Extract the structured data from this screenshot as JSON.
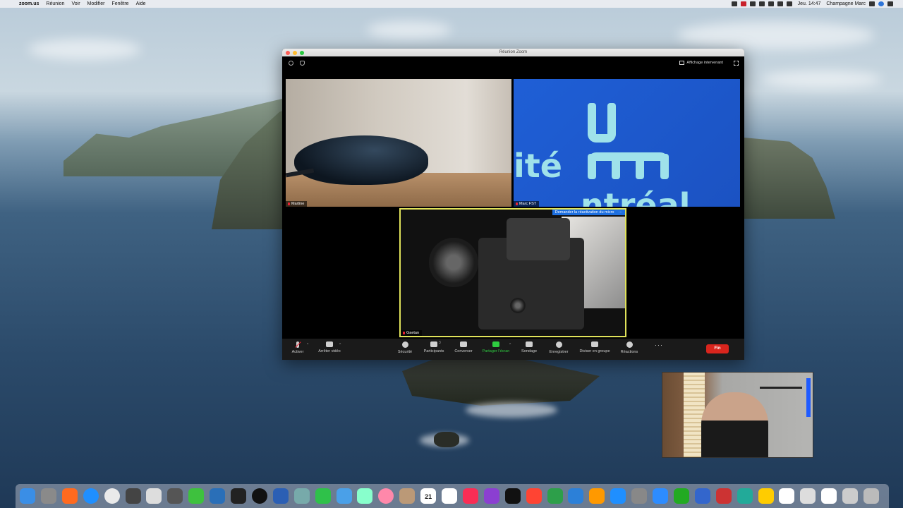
{
  "menubar": {
    "app_name": "zoom.us",
    "menus": [
      "Réunion",
      "Voir",
      "Modifier",
      "Fenêtre",
      "Aide"
    ],
    "clock": "Jeu. 14:47",
    "user": "Champagne Marc"
  },
  "window": {
    "title": "Réunion Zoom",
    "speaker_view_label": "Affichage intervenant"
  },
  "participants": {
    "martine": "Martine",
    "marc": "Marc FST",
    "gaetan": "Gaetan"
  },
  "shared_screen": {
    "line1": "ité",
    "line2": "ntréal"
  },
  "unmute_request": {
    "label": "Demander la réactivation du micro",
    "more": "···"
  },
  "toolbar": {
    "activate": "Activer",
    "stop_video": "Arrêter vidéo",
    "security": "Sécurité",
    "participants": "Participants",
    "participants_count": "3",
    "chat": "Converser",
    "share": "Partager l'écran",
    "poll": "Sondage",
    "record": "Enregistrer",
    "breakout": "Diviser en groupe",
    "reactions": "Réactions",
    "more": "···",
    "end": "Fin"
  },
  "colors": {
    "end_button": "#d9251d",
    "share_green": "#2ecc40",
    "active_speaker_border": "#e0e25a",
    "shared_screen_blue": "#1f5fd6"
  },
  "dock": {
    "icons": [
      "finder-icon",
      "launchpad-icon",
      "firefox-icon",
      "safari-icon",
      "chrome-icon",
      "final-cut-icon",
      "preview-icon",
      "app-icon",
      "camtasia-icon",
      "app-icon-2",
      "terminal-icon",
      "obs-icon",
      "word-icon",
      "app-icon-3",
      "messages-icon",
      "app-icon-4",
      "maps-icon",
      "photos-icon",
      "app-icon-5",
      "calendar-icon",
      "reminders-icon",
      "music-icon",
      "podcasts-icon",
      "tv-icon",
      "news-icon",
      "numbers-icon",
      "keynote-icon",
      "pages-icon",
      "app-store-icon",
      "system-prefs-icon",
      "zoom-icon",
      "app-icon-6",
      "app-icon-7",
      "app-icon-8",
      "app-icon-9",
      "app-icon-10",
      "folder-icon",
      "folder-icon-2",
      "folder-icon-3",
      "folder-icon-4",
      "trash-icon"
    ],
    "calendar_day": "21"
  }
}
